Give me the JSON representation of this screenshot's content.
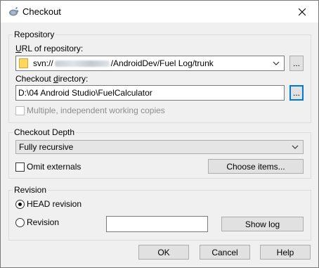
{
  "window": {
    "title": "Checkout"
  },
  "repository": {
    "group_label": "Repository",
    "url_label": "URL of repository:",
    "url_prefix": "svn://",
    "url_suffix": "/AndroidDev/Fuel Log/trunk",
    "browse_label": "...",
    "dir_label": "Checkout directory:",
    "dir_value": "D:\\04 Android Studio\\FuelCalculator",
    "dir_browse_label": "...",
    "multiple_label": "Multiple, independent working copies"
  },
  "depth": {
    "group_label": "Checkout Depth",
    "selected": "Fully recursive",
    "omit_label": "Omit externals",
    "choose_label": "Choose items..."
  },
  "revision": {
    "group_label": "Revision",
    "head_label": "HEAD revision",
    "rev_label": "Revision",
    "rev_value": "",
    "show_log_label": "Show log"
  },
  "buttons": {
    "ok": "OK",
    "cancel": "Cancel",
    "help": "Help"
  },
  "colors": {
    "focus": "#0078d7",
    "folder": "#ffd75e"
  }
}
